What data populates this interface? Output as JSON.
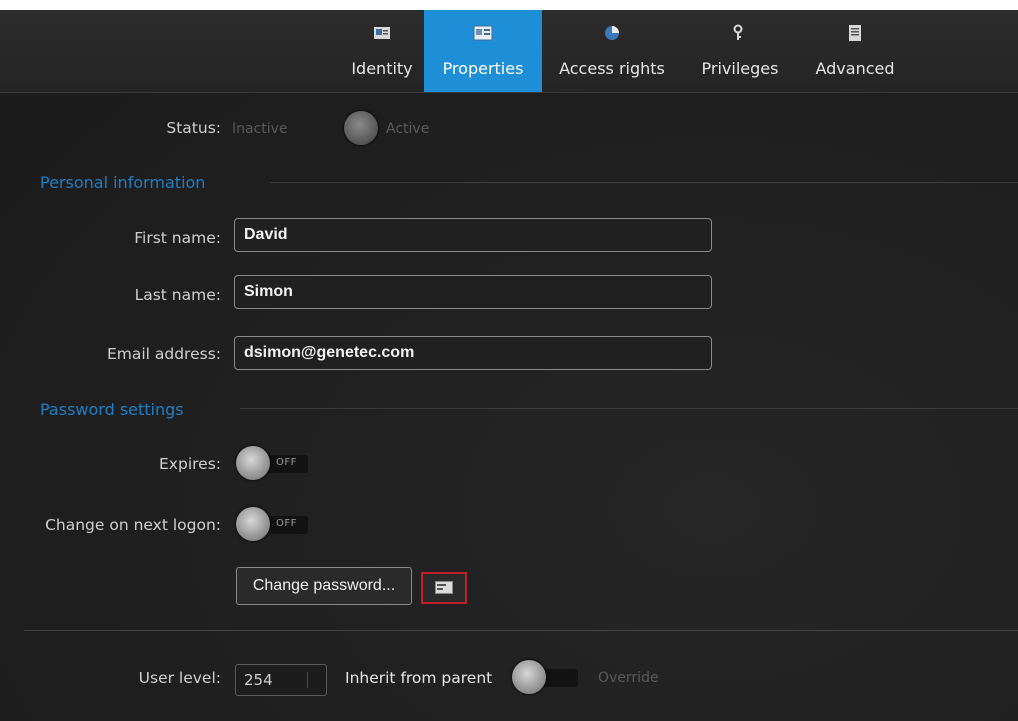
{
  "tabs": [
    {
      "label": "Identity",
      "icon": "identity-card-icon",
      "active": false
    },
    {
      "label": "Properties",
      "icon": "properties-icon",
      "active": true
    },
    {
      "label": "Access rights",
      "icon": "access-rights-icon",
      "active": false
    },
    {
      "label": "Privileges",
      "icon": "privileges-key-icon",
      "active": false
    },
    {
      "label": "Advanced",
      "icon": "advanced-document-icon",
      "active": false
    }
  ],
  "status": {
    "label": "Status:",
    "off_text": "Inactive",
    "on_text": "Active"
  },
  "personal": {
    "title": "Personal information",
    "first_name_label": "First name:",
    "first_name_value": "David",
    "last_name_label": "Last name:",
    "last_name_value": "Simon",
    "email_label": "Email address:",
    "email_value": "dsimon@genetec.com"
  },
  "password": {
    "title": "Password settings",
    "expires_label": "Expires:",
    "expires_state": "OFF",
    "change_on_logon_label": "Change on next logon:",
    "change_on_logon_state": "OFF",
    "change_button": "Change password..."
  },
  "user_level": {
    "label": "User level:",
    "value": "254",
    "inherit_label": "Inherit from parent",
    "override_label": "Override"
  },
  "colors": {
    "accent": "#1e8ed6",
    "section_title": "#1f7fc4",
    "highlight_border": "#c0202a"
  }
}
